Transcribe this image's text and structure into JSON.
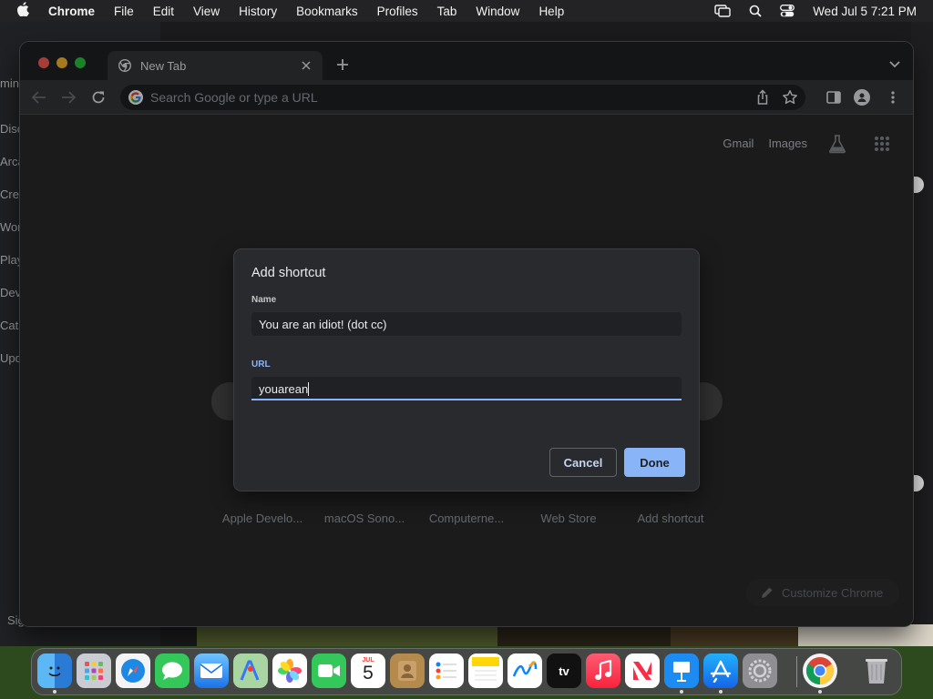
{
  "menubar": {
    "app_name": "Chrome",
    "items": [
      "File",
      "Edit",
      "View",
      "History",
      "Bookmarks",
      "Profiles",
      "Tab",
      "Window",
      "Help"
    ],
    "clock": "Wed Jul 5  7:21 PM"
  },
  "background_app": {
    "labels": [
      "mine",
      "Disc",
      "Arca",
      "Crea",
      "Wor",
      "Play",
      "Dev",
      "Cat",
      "Upd",
      "Sig"
    ]
  },
  "browser": {
    "tab_title": "New Tab",
    "omnibox_placeholder": "Search Google or type a URL",
    "top_links": {
      "gmail": "Gmail",
      "images": "Images"
    },
    "shortcut_labels": [
      "Apple Develo...",
      "macOS Sono...",
      "Computerne...",
      "Web Store",
      "Add shortcut"
    ],
    "customize_label": "Customize Chrome"
  },
  "dialog": {
    "title": "Add shortcut",
    "name_label": "Name",
    "name_value": "You are an idiot! (dot cc)",
    "url_label": "URL",
    "url_value": "youarean",
    "cancel_label": "Cancel",
    "done_label": "Done"
  },
  "dock": {
    "apps": [
      "Finder",
      "Launchpad",
      "Safari",
      "Messages",
      "Mail",
      "Maps",
      "Photos",
      "FaceTime",
      "Calendar",
      "Contacts",
      "Reminders",
      "Notes",
      "Freeform",
      "TV",
      "Music",
      "News",
      "Keynote",
      "App Store",
      "System Settings",
      "Google Chrome",
      "Trash"
    ],
    "calendar_month": "JUL",
    "calendar_day": "5",
    "tv_label": "tv"
  },
  "colors": {
    "accent": "#8ab4f8",
    "window_bg": "#202124",
    "dialog_bg": "#292a2d",
    "toolbar_bg": "#35363a"
  }
}
